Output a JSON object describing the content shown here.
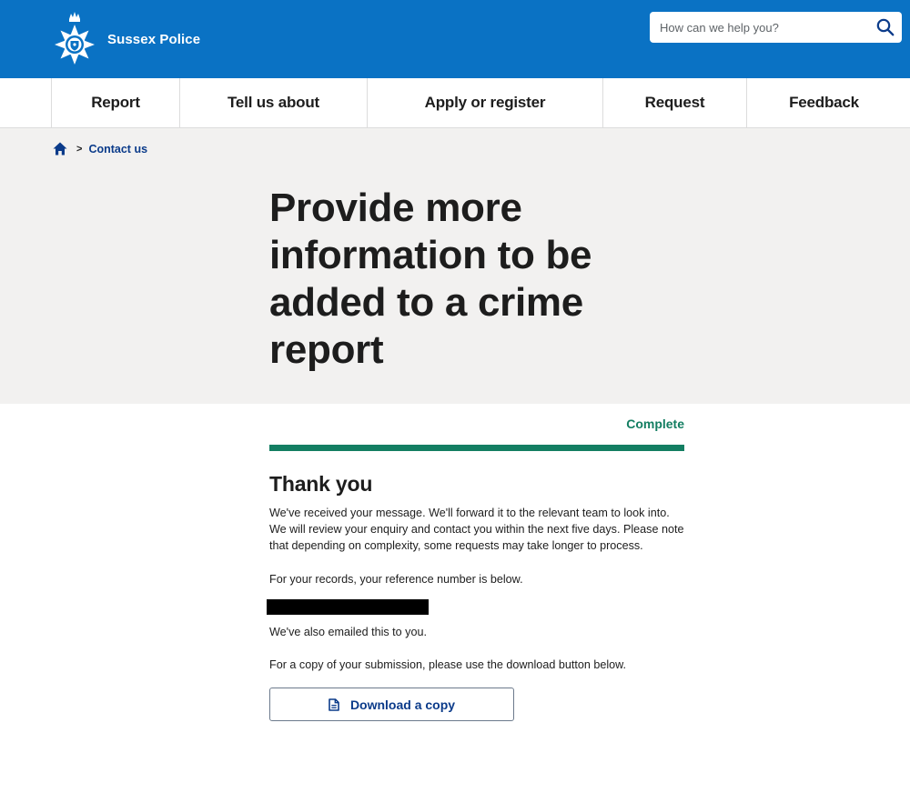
{
  "header": {
    "brand_name": "Sussex Police",
    "search_placeholder": "How can we help you?",
    "icons": {
      "logo": "police-crest-icon",
      "search": "search-icon"
    }
  },
  "nav": {
    "items": [
      {
        "label": "Report"
      },
      {
        "label": "Tell us about"
      },
      {
        "label": "Apply or register"
      },
      {
        "label": "Request"
      },
      {
        "label": "Feedback"
      }
    ]
  },
  "breadcrumb": {
    "home_icon": "home-icon",
    "separator": ">",
    "current": "Contact us"
  },
  "page": {
    "title": "Provide more information to be added to a crime report"
  },
  "form": {
    "status": "Complete",
    "progress_percent": 100,
    "heading": "Thank you",
    "message": "We've received your message. We'll forward it to the relevant team to look into. We will review your enquiry and contact you within the next five days. Please note that depending on complexity, some requests may take longer to process.",
    "reference_intro": "For your records, your reference number is below.",
    "emailed_note": "We've also emailed this to you.",
    "download_intro": "For a copy of your submission, please use the download button below.",
    "download_label": "Download a copy",
    "download_icon": "document-icon"
  },
  "colors": {
    "header_blue": "#0a72c4",
    "hero_grey": "#f2f1f0",
    "success_green": "#137e62",
    "link_blue": "#0b3b8a"
  }
}
